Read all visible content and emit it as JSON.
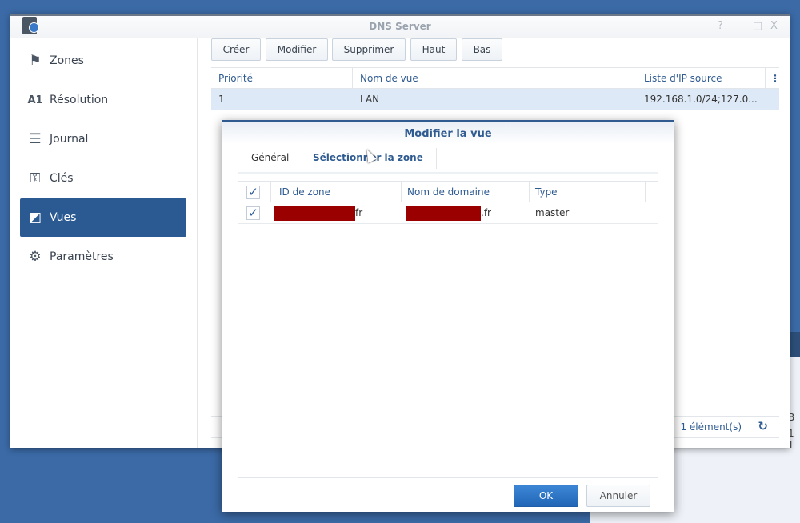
{
  "window": {
    "title": "DNS Server",
    "controls": [
      "?",
      "–",
      "□",
      "X"
    ]
  },
  "sidebar": {
    "items": [
      {
        "label": "Zones",
        "icon": "flag-icon"
      },
      {
        "label": "Résolution",
        "icon": "resolution-icon"
      },
      {
        "label": "Journal",
        "icon": "log-icon"
      },
      {
        "label": "Clés",
        "icon": "key-icon"
      },
      {
        "label": "Vues",
        "icon": "views-icon",
        "active": true
      },
      {
        "label": "Paramètres",
        "icon": "gear-icon"
      }
    ]
  },
  "toolbar": {
    "create": "Créer",
    "modify": "Modifier",
    "delete": "Supprimer",
    "up": "Haut",
    "down": "Bas"
  },
  "grid": {
    "columns": [
      "Priorité",
      "Nom de vue",
      "Liste d'IP source"
    ],
    "rows": [
      {
        "priority": "1",
        "name": "LAN",
        "ips": "192.168.1.0/24;127.0..."
      }
    ],
    "count": "1 élément(s)"
  },
  "dialog": {
    "title": "Modifier la vue",
    "tabs": [
      "Général",
      "Sélectionner la zone"
    ],
    "columns": [
      "ID de zone",
      "Nom de domaine",
      "Type"
    ],
    "rows": [
      {
        "checked": true,
        "zone_id_suffix": "fr",
        "domain_suffix": ".fr",
        "type": "master"
      }
    ],
    "ok": "OK",
    "cancel": "Annuler"
  },
  "background_window": {
    "text1": "B",
    "text2": "1 T"
  },
  "colors": {
    "accent": "#2b5a92",
    "desktop": "#3b6aa6",
    "redaction": "#9b0000"
  }
}
